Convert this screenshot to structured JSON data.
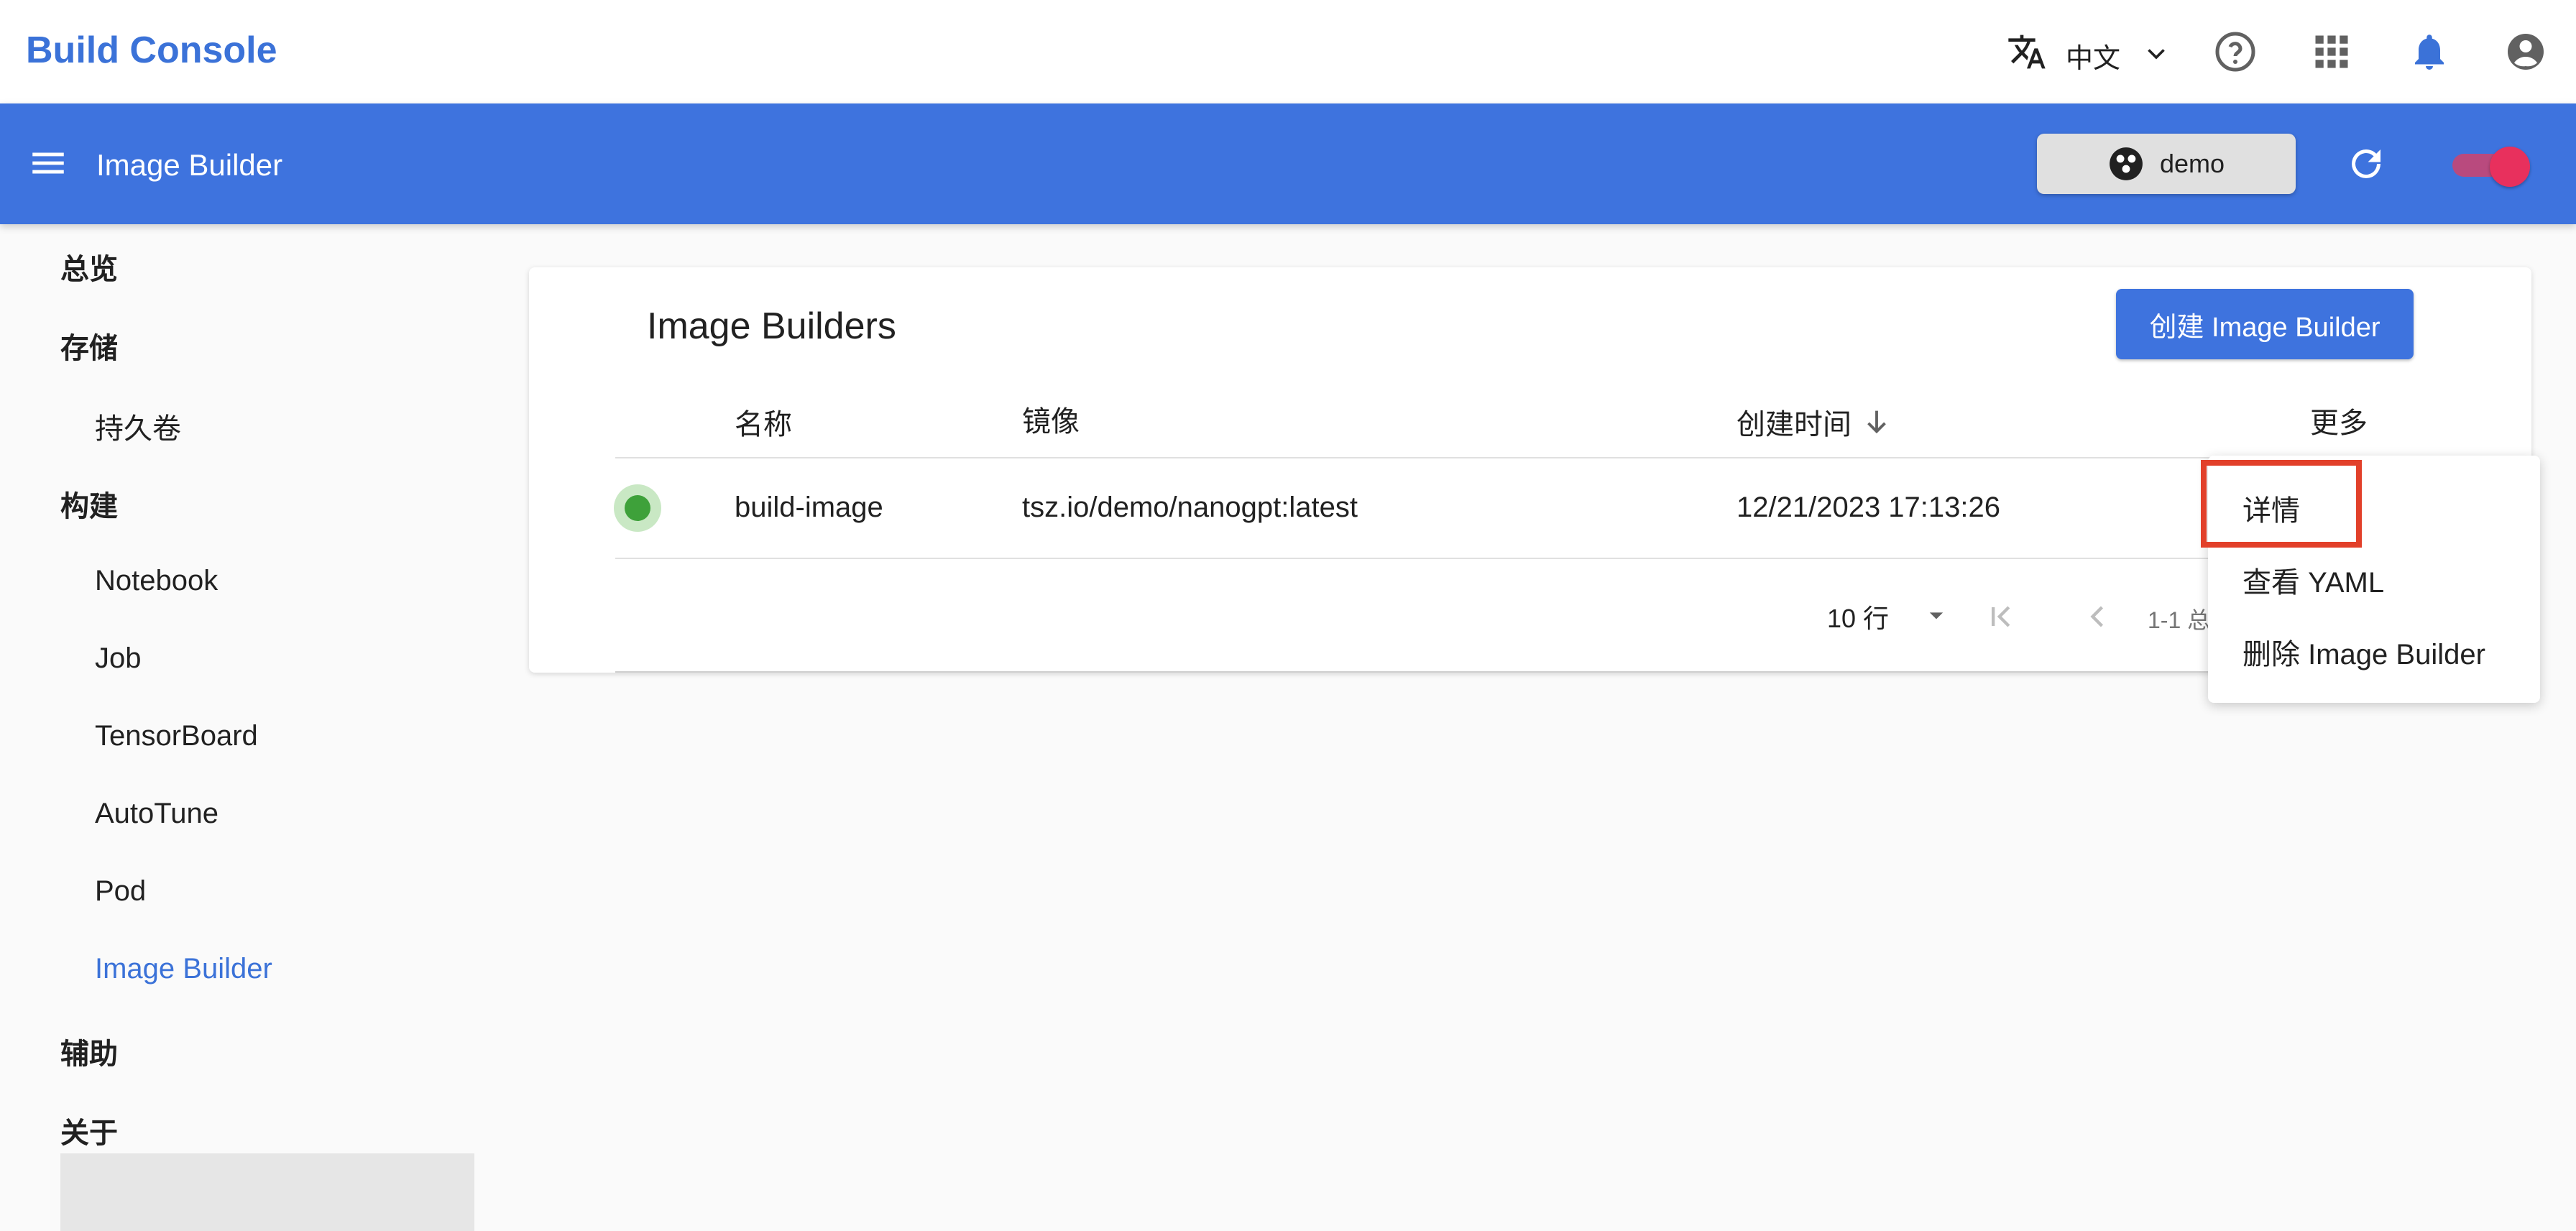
{
  "topbar": {
    "brand": "Build Console",
    "language_label": "中文",
    "icons": [
      "translate-icon",
      "chevron-down-icon",
      "help-icon",
      "apps-icon",
      "bell-icon",
      "account-icon"
    ]
  },
  "appbar": {
    "title": "Image Builder",
    "namespace_label": "demo",
    "icons": [
      "menu-icon",
      "namespace-icon",
      "refresh-icon"
    ],
    "toggle_on": true,
    "colors": {
      "bar": "#3e73de",
      "toggle_thumb": "#e8305d"
    }
  },
  "sidebar": {
    "items": [
      {
        "label": "总览"
      },
      {
        "label": "存储"
      },
      {
        "label": "持久卷"
      },
      {
        "label": "构建"
      },
      {
        "label": "Notebook"
      },
      {
        "label": "Job"
      },
      {
        "label": "TensorBoard"
      },
      {
        "label": "AutoTune"
      },
      {
        "label": "Pod"
      },
      {
        "label": "Image Builder",
        "active": true
      },
      {
        "label": "辅助"
      },
      {
        "label": "关于"
      }
    ],
    "active_color": "#3b72d8"
  },
  "main": {
    "title": "Image Builders",
    "create_button": "创建 Image Builder",
    "columns": {
      "name": "名称",
      "image": "镜像",
      "created": "创建时间",
      "more": "更多"
    },
    "rows": [
      {
        "status": "running",
        "name": "build-image",
        "image": "tsz.io/demo/nanogpt:latest",
        "created": "12/21/2023 17:13:26"
      }
    ],
    "pagination": {
      "rows_per_page": "10 行",
      "range": "1-1 总"
    }
  },
  "context_menu": {
    "items": [
      "详情",
      "查看 YAML",
      "删除 Image Builder"
    ],
    "highlighted": "详情",
    "highlight_color": "#e2402a"
  }
}
